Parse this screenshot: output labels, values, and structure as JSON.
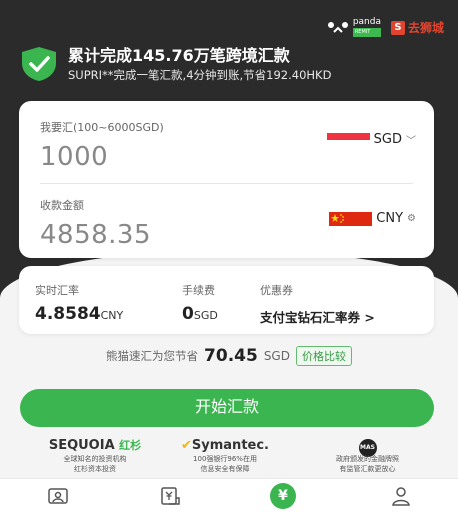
{
  "header": {
    "panda_brand": "panda",
    "panda_sub": "REMIT",
    "lion_brand": "去狮城"
  },
  "banner": {
    "title": "累计完成145.76万笔跨境汇款",
    "subtitle": "SUPRI**完成一笔汇款,4分钟到账,节省192.40HKD"
  },
  "send": {
    "label": "我要汇(100~6000SGD)",
    "amount": "1000",
    "currency": "SGD"
  },
  "receive": {
    "label": "收款金额",
    "amount": "4858.35",
    "currency": "CNY"
  },
  "rate": {
    "label": "实时汇率",
    "value": "4.8584",
    "unit": "CNY"
  },
  "fee": {
    "label": "手续费",
    "value": "0",
    "unit": "SGD"
  },
  "coupon": {
    "label": "优惠券",
    "value": "支付宝钻石汇率券",
    "arrow": ">"
  },
  "savings": {
    "text": "熊猫速汇为您节省",
    "amount": "70.45",
    "currency": "SGD",
    "compare": "价格比较"
  },
  "start_button": "开始汇款",
  "partners": [
    {
      "logo": "SEQUOIA",
      "line1": "全球知名的投资机构",
      "line2": "红杉资本投资"
    },
    {
      "logo": "Symantec.",
      "line1": "100强银行96%在用",
      "line2": "信息安全有保障"
    },
    {
      "logo": "MAS",
      "line1": "政府颁发的金融牌照",
      "line2": "有监管汇款更放心"
    }
  ],
  "tabs": {
    "exchange_symbol": "¥"
  },
  "colors": {
    "accent": "#3bb54f",
    "hero": "#2b2b2b",
    "brand_red": "#e2452f"
  }
}
